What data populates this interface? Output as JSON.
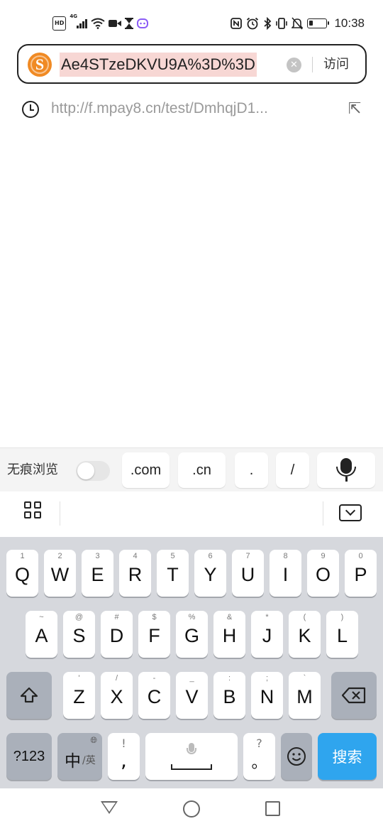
{
  "status_bar": {
    "hd_badge": "HD",
    "network_type": "4G",
    "time": "10:38",
    "battery_level_percent": 25,
    "left_icons": [
      "hd-icon",
      "4g-signal-icon",
      "wifi-icon",
      "video-camera-icon",
      "hourglass-icon",
      "app-notification-icon"
    ],
    "right_icons": [
      "nfc-icon",
      "alarm-icon",
      "bluetooth-icon",
      "vibrate-icon",
      "mute-icon",
      "battery-icon"
    ]
  },
  "url_bar": {
    "logo_icon": "sogou-logo",
    "logo_letter": "S",
    "url_text": "Ae4STzeDKVU9A%3D%3D",
    "visit_label": "访问",
    "clear_icon": "clear-icon",
    "brand_color": "#f08a24",
    "highlight_color": "#f7d7d4"
  },
  "suggestion": {
    "icon": "history-clock-icon",
    "text": "http://f.mpay8.cn/test/DmhqjD1...",
    "fill_icon": "fill-arrow-icon"
  },
  "shortcuts": {
    "incognito_label": "无痕浏览",
    "incognito_enabled": false,
    "keys": [
      ".com",
      ".cn",
      ".",
      "/"
    ],
    "voice_icon": "microphone-icon"
  },
  "toolbar": {
    "menu_icon": "grid-icon",
    "collapse_icon": "keyboard-collapse-icon"
  },
  "keyboard": {
    "row1": [
      {
        "letter": "Q",
        "hint": "1"
      },
      {
        "letter": "W",
        "hint": "2"
      },
      {
        "letter": "E",
        "hint": "3"
      },
      {
        "letter": "R",
        "hint": "4"
      },
      {
        "letter": "T",
        "hint": "5"
      },
      {
        "letter": "Y",
        "hint": "6"
      },
      {
        "letter": "U",
        "hint": "7"
      },
      {
        "letter": "I",
        "hint": "8"
      },
      {
        "letter": "O",
        "hint": "9"
      },
      {
        "letter": "P",
        "hint": "0"
      }
    ],
    "row2": [
      {
        "letter": "A",
        "hint": "~"
      },
      {
        "letter": "S",
        "hint": "@"
      },
      {
        "letter": "D",
        "hint": "#"
      },
      {
        "letter": "F",
        "hint": "$"
      },
      {
        "letter": "G",
        "hint": "%"
      },
      {
        "letter": "H",
        "hint": "&"
      },
      {
        "letter": "J",
        "hint": "*"
      },
      {
        "letter": "K",
        "hint": "("
      },
      {
        "letter": "L",
        "hint": ")"
      }
    ],
    "row3": [
      {
        "letter": "Z",
        "hint": "'"
      },
      {
        "letter": "X",
        "hint": "/"
      },
      {
        "letter": "C",
        "hint": "-"
      },
      {
        "letter": "V",
        "hint": "_"
      },
      {
        "letter": "B",
        "hint": ":"
      },
      {
        "letter": "N",
        "hint": ";"
      },
      {
        "letter": "M",
        "hint": "`"
      }
    ],
    "shift_icon": "shift-icon",
    "backspace_icon": "backspace-icon",
    "num_key": "?123",
    "lang_key": "中",
    "lang_sub": "/英",
    "globe_icon": "globe-icon",
    "punct_key_top": "!",
    "punct_key_bottom": ",",
    "space_mic_icon": "space-microphone-icon",
    "punct2_top": "?",
    "punct2_bottom": "。",
    "emoji_icon": "emoji-icon",
    "enter_label": "搜索",
    "enter_color": "#2fa5ee"
  },
  "nav_bar": {
    "back_icon": "back-triangle-icon",
    "home_icon": "home-circle-icon",
    "recent_icon": "recent-square-icon"
  }
}
